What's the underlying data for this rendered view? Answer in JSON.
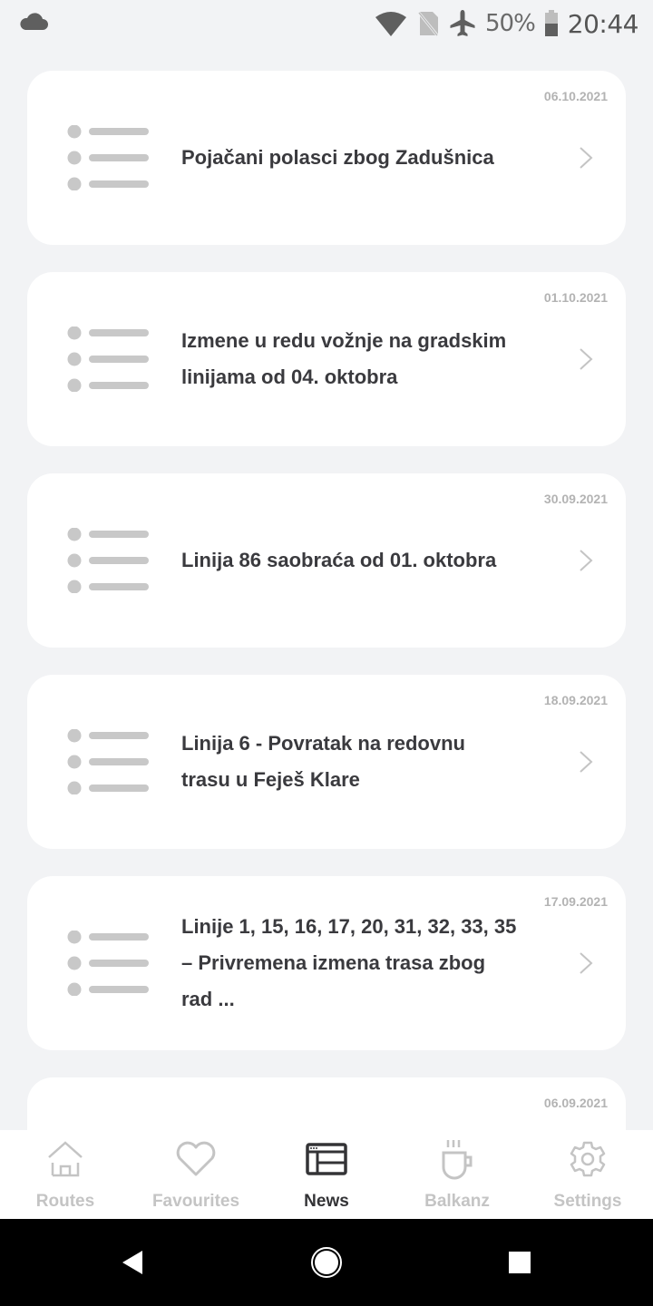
{
  "status_bar": {
    "battery_percent": "50%",
    "time": "20:44",
    "icons": [
      "cloud-icon",
      "wifi-icon",
      "no-sim-icon",
      "airplane-icon",
      "battery-icon"
    ]
  },
  "news": [
    {
      "date": "06.10.2021",
      "lines": [
        "Pojačani polasci zbog Zadušnica"
      ]
    },
    {
      "date": "01.10.2021",
      "lines": [
        "Izmene u redu vožnje na gradskim",
        "linijama od 04. oktobra"
      ]
    },
    {
      "date": "30.09.2021",
      "lines": [
        "Linija 86 saobraća od 01. oktobra"
      ]
    },
    {
      "date": "18.09.2021",
      "lines": [
        "Linija 6 - Povratak na redovnu",
        "trasu u Feješ Klare"
      ]
    },
    {
      "date": "17.09.2021",
      "lines": [
        "Linije 1, 15, 16, 17, 20, 31, 32, 33, 35",
        "– Privremena izmena trasa zbog",
        "rad ..."
      ]
    },
    {
      "date": "06.09.2021",
      "lines": []
    }
  ],
  "bottom_nav": {
    "active": "News",
    "items": [
      {
        "label": "Routes",
        "icon": "home-icon"
      },
      {
        "label": "Favourites",
        "icon": "heart-icon"
      },
      {
        "label": "News",
        "icon": "news-icon"
      },
      {
        "label": "Balkanz",
        "icon": "coffee-cup-icon"
      },
      {
        "label": "Settings",
        "icon": "gear-icon"
      }
    ]
  },
  "colors": {
    "background": "#f2f3f5",
    "card": "#ffffff",
    "title_text": "#3a3a3e",
    "date_text": "#b3b3b3",
    "inactive": "#c4c4c4",
    "active": "#333336"
  }
}
